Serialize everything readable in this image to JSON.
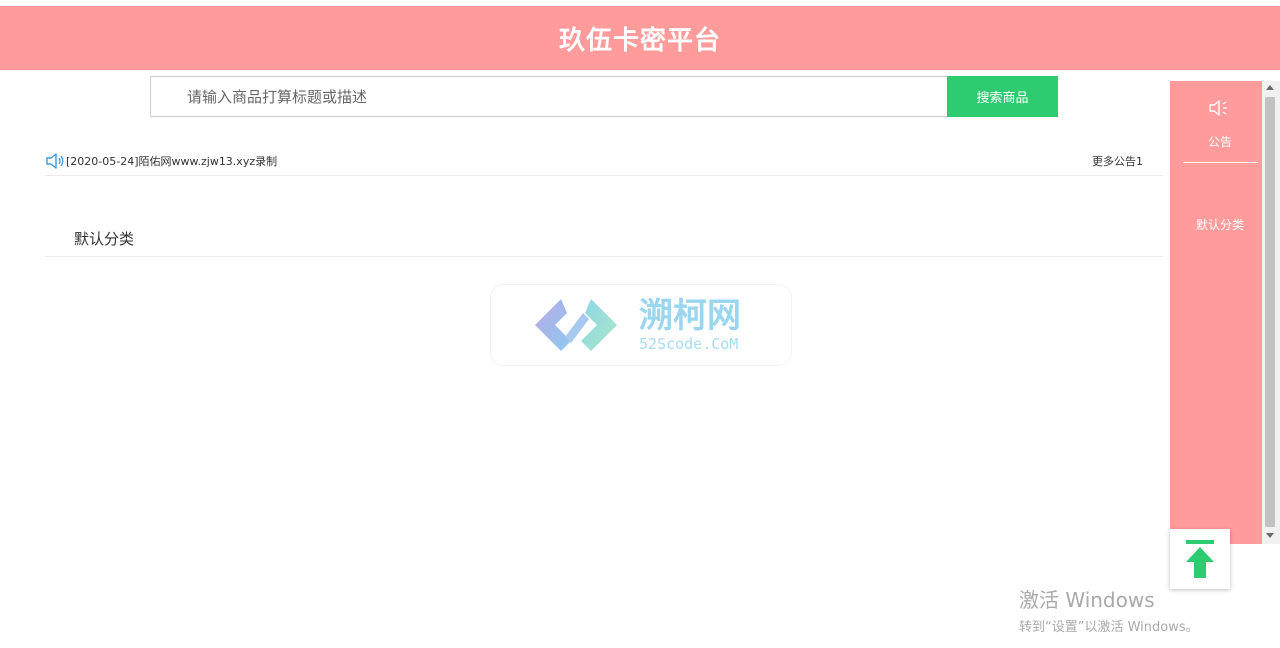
{
  "header": {
    "title": "玖伍卡密平台"
  },
  "search": {
    "placeholder": "请输入商品打算标题或描述",
    "value": "",
    "button_label": "搜索商品"
  },
  "notice": {
    "text": "[2020-05-24]陌佑网www.zjw13.xyz录制",
    "more_label": "更多公告1",
    "icon": "speaker-icon"
  },
  "category": {
    "title": "默认分类"
  },
  "watermark": {
    "main": "溯柯网",
    "sub": "52Scode.CoM"
  },
  "side_panel": {
    "notice_label": "公告",
    "category_label": "默认分类"
  },
  "back_to_top": {
    "icon": "arrow-up-to-top-icon"
  },
  "activation": {
    "title": "激活 Windows",
    "subtitle": "转到“设置”以激活 Windows。"
  },
  "colors": {
    "header_bg": "#ff9b9b",
    "accent_green": "#2ecc71",
    "notice_icon_blue": "#3a9be0"
  }
}
